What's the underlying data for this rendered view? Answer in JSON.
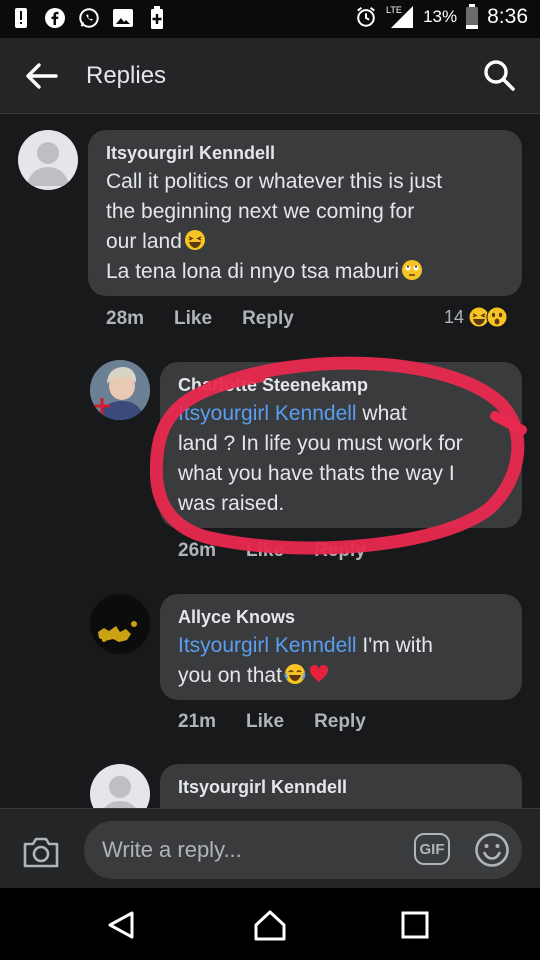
{
  "status_bar": {
    "battery_percent": "13%",
    "time": "8:36",
    "network_label": "LTE",
    "left_icons": [
      "alert-icon",
      "facebook-icon",
      "whatsapp-icon",
      "image-icon",
      "battery-saver-icon"
    ],
    "right_icons": [
      "alarm-icon",
      "signal-icon",
      "battery-icon"
    ]
  },
  "header": {
    "title": "Replies",
    "back_icon": "arrow-left-icon",
    "search_icon": "search-icon"
  },
  "comments": [
    {
      "author": "Itsyourgirl Kenndell",
      "lines": [
        "Call it politics or whatever this is just",
        "the beginning  next we coming for",
        "our land",
        "La tena lona di nnyo tsa maburi"
      ],
      "time": "28m",
      "like": "Like",
      "reply": "Reply",
      "reaction_count": "14"
    },
    {
      "author": "Charlotte Steenekamp",
      "mention": "Itsyourgirl Kenndell",
      "text_after_mention": " what",
      "lines": [
        "land ? In life you must work for",
        "what you have thats the way I",
        "was raised."
      ],
      "time": "26m",
      "like": "Like",
      "reply": "Reply"
    },
    {
      "author": "Allyce Knows",
      "mention": "Itsyourgirl Kenndell",
      "text_after_mention": " I'm with",
      "lines": [
        "you on that"
      ],
      "time": "21m",
      "like": "Like",
      "reply": "Reply"
    },
    {
      "author": "Itsyourgirl Kenndell"
    }
  ],
  "composer": {
    "placeholder": "Write a reply...",
    "gif_label": "GIF",
    "camera_icon": "camera-icon",
    "emoji_icon": "smiley-icon"
  },
  "nav_bar": {
    "icons": [
      "back-triangle-icon",
      "home-icon",
      "recents-icon"
    ]
  },
  "colors": {
    "background": "#18191a",
    "bubble": "#3a3b3c",
    "mention": "#5a9ef2",
    "annotation": "#e8294f"
  }
}
